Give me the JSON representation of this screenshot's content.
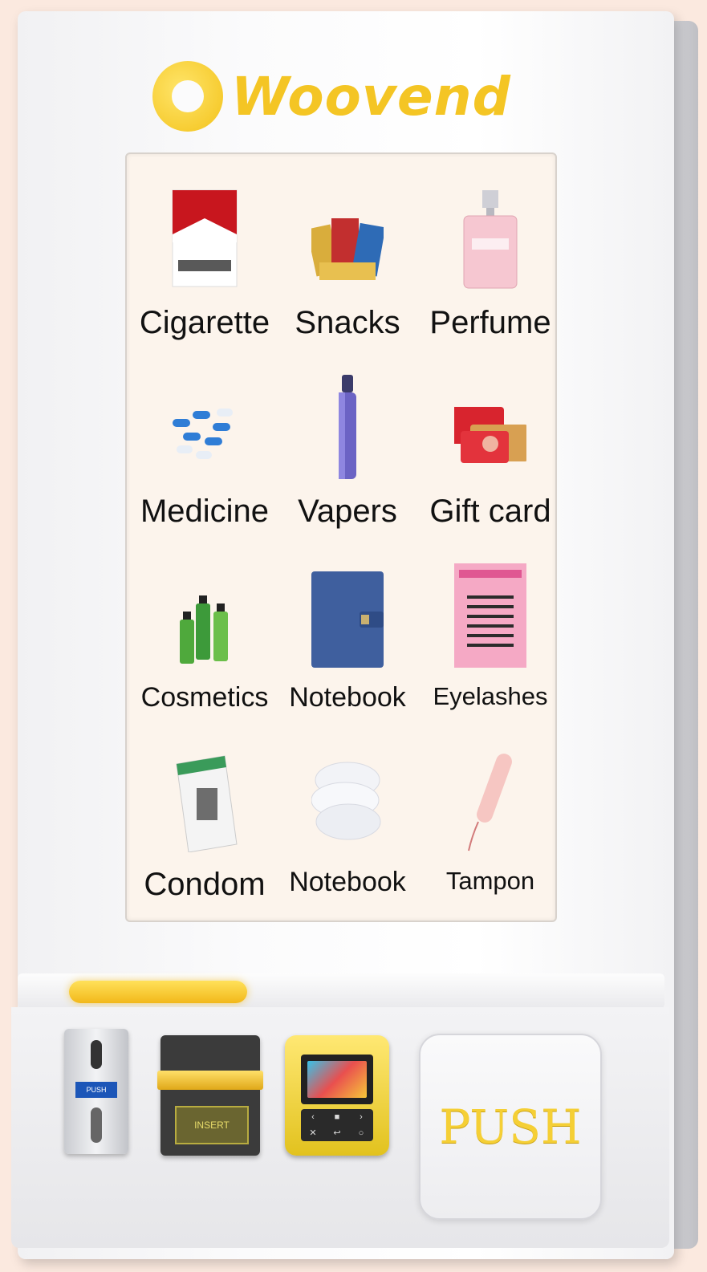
{
  "brand": {
    "name": "Woovend",
    "accent_color": "#f4c524"
  },
  "screen": {
    "products": [
      {
        "label": "Cigarette",
        "icon": "cigarette-pack-icon"
      },
      {
        "label": "Snacks",
        "icon": "snacks-pile-icon"
      },
      {
        "label": "Perfume",
        "icon": "perfume-bottle-icon"
      },
      {
        "label": "Medicine",
        "icon": "capsules-icon"
      },
      {
        "label": "Vapers",
        "icon": "vape-pen-icon"
      },
      {
        "label": "Gift card",
        "icon": "gift-card-icon"
      },
      {
        "label": "Cosmetics",
        "icon": "cosmetic-bottles-icon"
      },
      {
        "label": "Notebook",
        "icon": "notebook-icon"
      },
      {
        "label": "Eyelashes",
        "icon": "eyelashes-box-icon"
      },
      {
        "label": "Condom",
        "icon": "condom-box-icon"
      },
      {
        "label": "Notebook",
        "icon": "sanitary-pads-icon"
      },
      {
        "label": "Tampon",
        "icon": "tampon-icon"
      }
    ]
  },
  "panel": {
    "coin_badge": "PUSH",
    "bill_plate": "INSERT",
    "push_label": "PUSH"
  }
}
